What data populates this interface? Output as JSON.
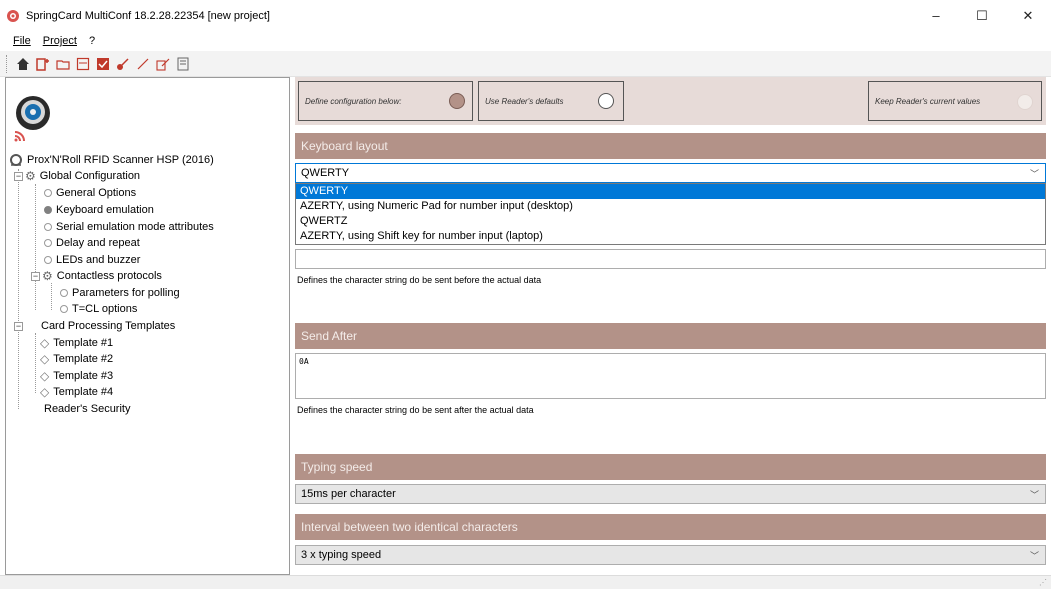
{
  "window": {
    "title": "SpringCard MultiConf 18.2.28.22354 [new project]",
    "minimize": "–",
    "maximize": "☐",
    "close": "✕"
  },
  "menu": [
    "File",
    "Project",
    "?"
  ],
  "toolbar": {
    "icons": [
      "home-icon",
      "new-icon",
      "open-icon",
      "save-icon",
      "save-as-icon",
      "key-icon",
      "pen-icon",
      "write-icon",
      "page-icon"
    ]
  },
  "tree": {
    "root": "Prox'N'Roll RFID Scanner HSP (2016)",
    "global": "Global Configuration",
    "general": "General Options",
    "keyboard": "Keyboard emulation",
    "serial": "Serial emulation mode attributes",
    "delay": "Delay and repeat",
    "leds": "LEDs and buzzer",
    "contactless": "Contactless protocols",
    "polling": "Parameters for polling",
    "tcl": "T=CL options",
    "templates": "Card Processing Templates",
    "t1": "Template #1",
    "t2": "Template #2",
    "t3": "Template #3",
    "t4": "Template #4",
    "security": "Reader's Security"
  },
  "modes": {
    "define": "Define configuration below:",
    "defaults": "Use Reader's defaults",
    "keep": "Keep Reader's current values"
  },
  "keyboard_layout": {
    "header": "Keyboard layout",
    "value": "QWERTY",
    "options": [
      "QWERTY",
      "AZERTY, using Numeric Pad for number input (desktop)",
      "QWERTZ",
      "AZERTY, using Shift key for number input (laptop)"
    ]
  },
  "send_before": {
    "value": "",
    "hint": "Defines the character string do be sent before the actual data"
  },
  "send_after": {
    "header": "Send After",
    "value": "0A",
    "hint": "Defines the character string do be sent after the actual data"
  },
  "typing_speed": {
    "header": "Typing speed",
    "value": "15ms per character"
  },
  "interval": {
    "header": "Interval between two identical characters",
    "value": "3 x typing speed"
  },
  "colors": {
    "header_bg": "#b39288",
    "mode_bar_bg": "#e7dbd8",
    "selection": "#0078d7"
  }
}
